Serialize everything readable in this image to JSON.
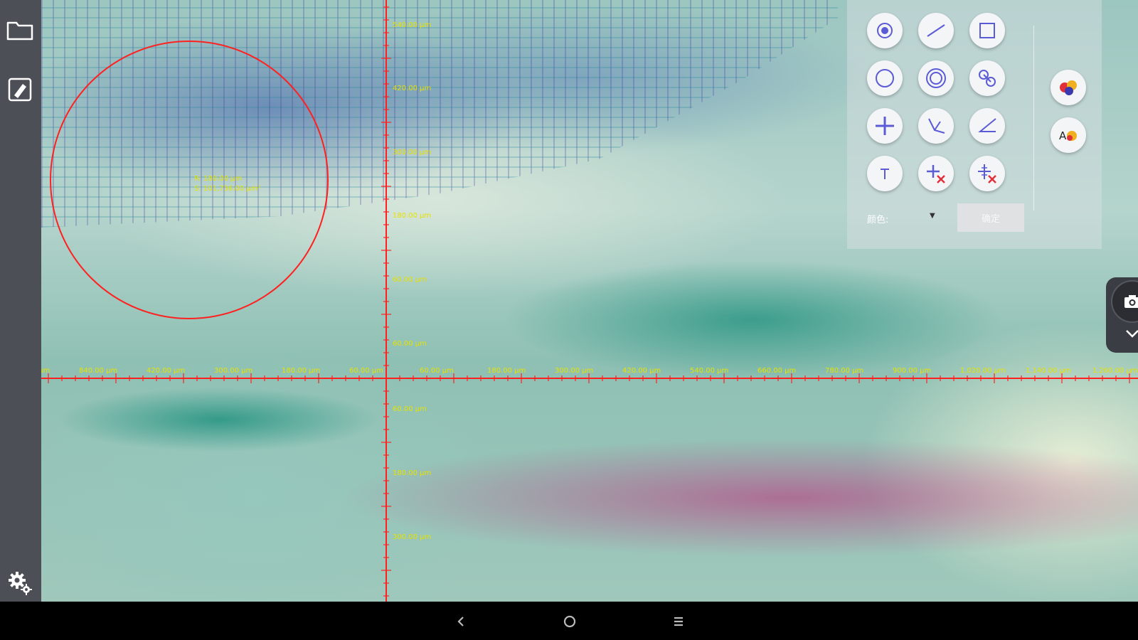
{
  "app": {
    "accent_color": "#ff2020",
    "label_color": "#e6e200"
  },
  "sidebar": {
    "items": [
      {
        "icon": "folder-icon"
      },
      {
        "icon": "edit-icon"
      },
      {
        "icon": "settings-icon"
      }
    ]
  },
  "measurement": {
    "unit": "µm",
    "x_ticks": [
      "960.00 µm",
      "840.00 µm",
      "420.00 µm",
      "300.00 µm",
      "180.00 µm",
      "60.00 µm",
      "60.00 µm",
      "180.00 µm",
      "300.00 µm",
      "420.00 µm",
      "540.00 µm",
      "660.00 µm",
      "780.00 µm",
      "900.00 µm",
      "1,020.00 µm",
      "1,140.00 µm",
      "1,260.00 µm"
    ],
    "y_ticks_up": [
      "540.00 µm",
      "420.00 µm",
      "300.00 µm",
      "180.00 µm",
      "60.00 µm",
      "60.00 µm"
    ],
    "y_ticks_down": [
      "60.00 µm",
      "180.00 µm",
      "300.00 µm"
    ],
    "circle_label": [
      "R: 180.00 µm",
      "S: 101,736.00 µm²"
    ]
  },
  "tool_panel": {
    "tools": [
      {
        "name": "point-tool",
        "icon": "point-icon"
      },
      {
        "name": "line-tool",
        "icon": "line-icon"
      },
      {
        "name": "rectangle-tool",
        "icon": "rectangle-icon"
      },
      {
        "name": "circle-tool",
        "icon": "circle-icon"
      },
      {
        "name": "concentric-circle-tool",
        "icon": "concentric-circle-icon"
      },
      {
        "name": "two-circles-tool",
        "icon": "two-circles-icon"
      },
      {
        "name": "crosshair-tool",
        "icon": "crosshair-icon"
      },
      {
        "name": "angle-tool",
        "icon": "angle-icon"
      },
      {
        "name": "angle-line-tool",
        "icon": "angle-line-icon"
      },
      {
        "name": "text-tool",
        "icon": "text-icon"
      },
      {
        "name": "delete-crosshair-tool",
        "icon": "delete-crosshair-icon"
      },
      {
        "name": "delete-scale-tool",
        "icon": "delete-scale-icon"
      }
    ],
    "side_tools": [
      {
        "name": "color-palette-tool",
        "icon": "palette-icon"
      },
      {
        "name": "text-color-tool",
        "icon": "text-color-icon"
      }
    ],
    "color_label": "颜色:",
    "confirm_label": "确定"
  },
  "camera": {
    "icon": "camera-icon",
    "collapse_icon": "chevron-down-icon"
  },
  "navbar": {
    "items": [
      {
        "name": "back",
        "icon": "back-icon"
      },
      {
        "name": "home",
        "icon": "home-icon"
      },
      {
        "name": "recents",
        "icon": "recents-icon"
      }
    ]
  }
}
